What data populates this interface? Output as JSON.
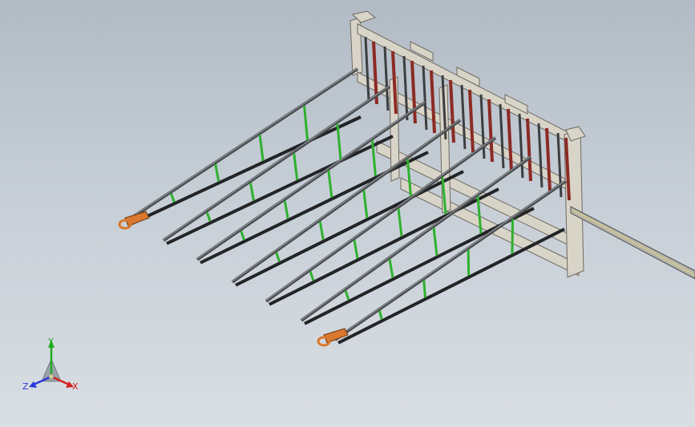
{
  "viewport": {
    "background_top": "#b2bbc5",
    "background_bottom": "#d9dee3"
  },
  "model": {
    "frame_color": "#d8d4c8",
    "frame_stroke": "#6e6a60",
    "arm_color": "#4a4c4e",
    "arm_highlight": "#9aa0a6",
    "strut_color": "#2fb02f",
    "slot_color": "#8c2a24",
    "hook_color": "#d9782e"
  },
  "triad": {
    "x_label": "X",
    "y_label": "Y",
    "z_label": "Z",
    "x_color": "#d22020",
    "y_color": "#1faa1f",
    "z_color": "#2a3ad6"
  }
}
